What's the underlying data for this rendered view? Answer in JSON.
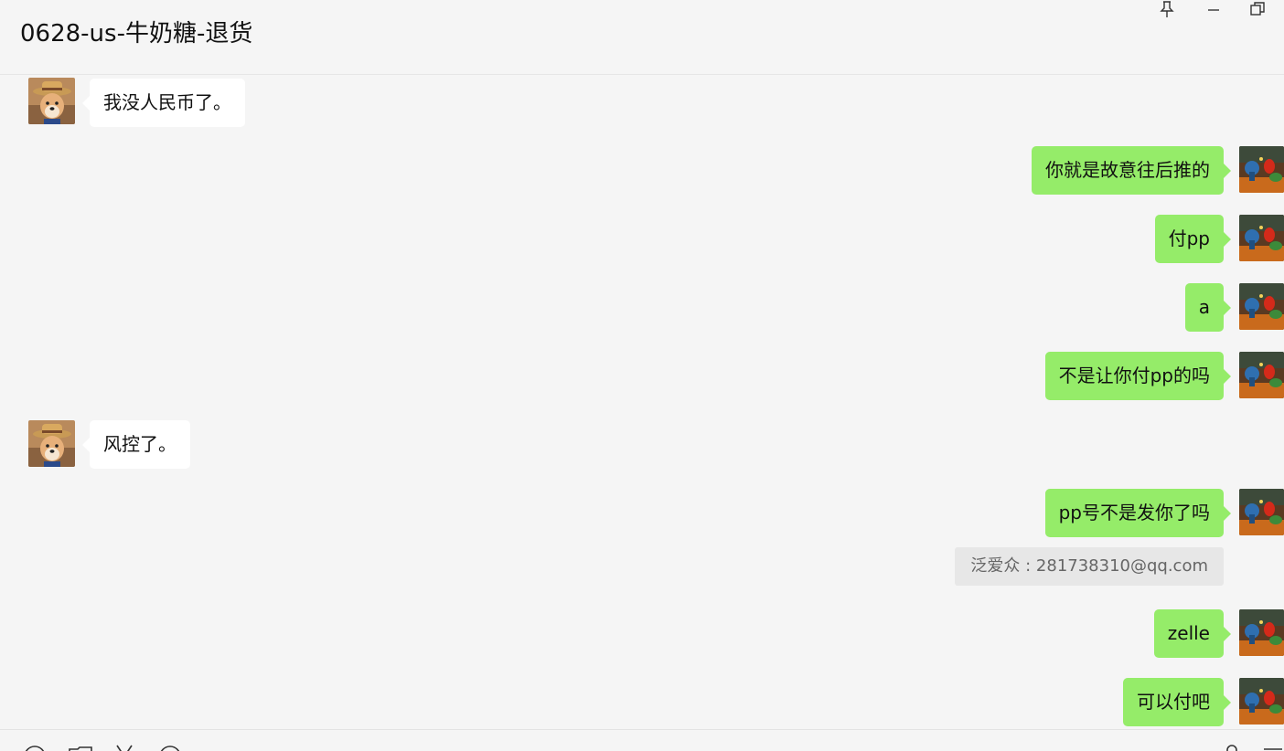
{
  "header": {
    "title": "0628-us-牛奶糖-退货"
  },
  "window_controls": [
    "pin-icon",
    "minimize-icon",
    "restore-icon"
  ],
  "colors": {
    "background": "#f5f5f5",
    "own_bubble": "#95ec69",
    "other_bubble": "#ffffff",
    "quote_bg": "#e7e7e7"
  },
  "messages": [
    {
      "side": "left",
      "text": "我没人民币了。"
    },
    {
      "side": "right",
      "text": "你就是故意往后推的"
    },
    {
      "side": "right",
      "text": "付pp"
    },
    {
      "side": "right",
      "text": "a"
    },
    {
      "side": "right",
      "text": "不是让你付pp的吗"
    },
    {
      "side": "left",
      "text": "风控了。"
    },
    {
      "side": "right",
      "text": "pp号不是发你了吗"
    },
    {
      "side": "right",
      "text": "zelle"
    },
    {
      "side": "right",
      "text": "可以付吧"
    }
  ],
  "quote": {
    "text": "泛爱众 : 281738310@qq.com"
  },
  "toolbar": [
    "emoji-icon",
    "folder-icon",
    "scissors-icon",
    "chat-history-icon",
    "microphone-icon",
    "menu-icon"
  ]
}
